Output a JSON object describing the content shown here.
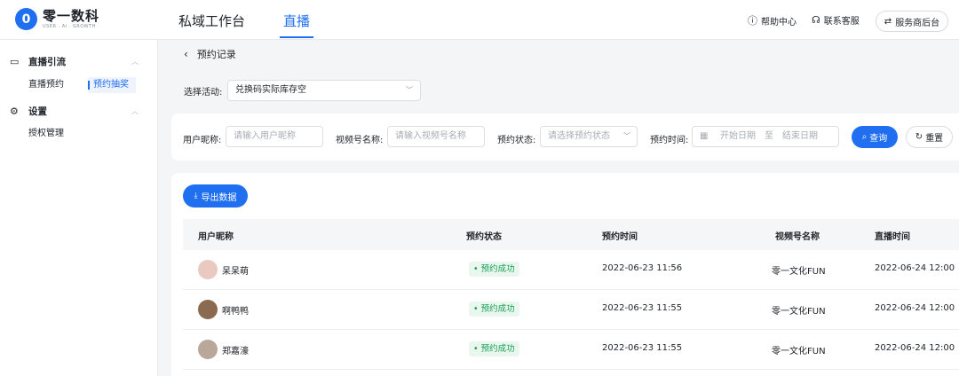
{
  "brand": {
    "name": "零一数科",
    "tagline": "USER · AI · GROWTH",
    "mark": "0"
  },
  "nav": {
    "tabs": [
      {
        "label": "私域工作台"
      },
      {
        "label": "直播"
      }
    ]
  },
  "top_actions": {
    "help": "帮助中心",
    "contact": "联系客服",
    "service": "服务商后台"
  },
  "sidebar": {
    "groups": [
      {
        "label": "直播引流",
        "items": [
          {
            "label": "直播预约"
          },
          {
            "label": "预约抽奖"
          }
        ]
      },
      {
        "label": "设置",
        "items": [
          {
            "label": "授权管理"
          }
        ]
      }
    ]
  },
  "breadcrumb": {
    "title": "预约记录"
  },
  "activity": {
    "label": "选择活动:",
    "value": "兑换码实际库存空"
  },
  "filters": {
    "nickname": {
      "label": "用户昵称:",
      "placeholder": "请输入用户昵称"
    },
    "channel": {
      "label": "视频号名称:",
      "placeholder": "请输入视频号名称"
    },
    "status": {
      "label": "预约状态:",
      "placeholder": "请选择预约状态"
    },
    "time": {
      "label": "预约时间:",
      "start": "开始日期",
      "sep": "至",
      "end": "结束日期"
    },
    "query": "查询",
    "reset": "重置"
  },
  "table": {
    "export": "导出数据",
    "columns": [
      "用户昵称",
      "预约状态",
      "预约时间",
      "视频号名称",
      "直播时间"
    ],
    "rows": [
      {
        "nickname": "呆呆萌",
        "status": "• 预约成功",
        "reserve_time": "2022-06-23 11:56",
        "channel": "零一文化FUN",
        "live_time": "2022-06-24 12:00",
        "avatar_color": "#e9c9c0"
      },
      {
        "nickname": "啊鸭鸭",
        "status": "• 预约成功",
        "reserve_time": "2022-06-23 11:55",
        "channel": "零一文化FUN",
        "live_time": "2022-06-24 12:00",
        "avatar_color": "#8a6a50"
      },
      {
        "nickname": "郑嘉濠",
        "status": "• 预约成功",
        "reserve_time": "2022-06-23 11:55",
        "channel": "零一文化FUN",
        "live_time": "2022-06-24 12:00",
        "avatar_color": "#b9a79a"
      }
    ]
  },
  "colors": {
    "accent": "#1f6ff0",
    "success": "#18a058",
    "success_bg": "#e9f7ee"
  }
}
